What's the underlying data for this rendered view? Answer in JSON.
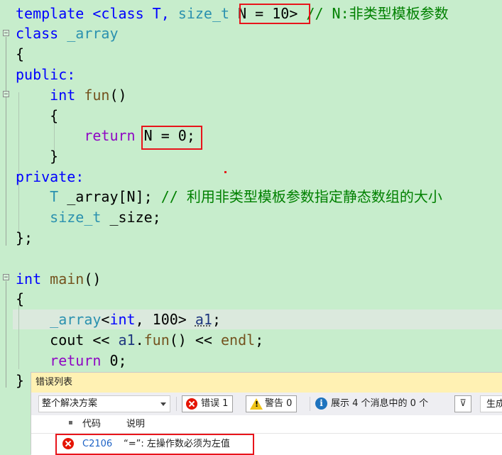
{
  "code": {
    "lines": [
      [
        "template ",
        "<class T, ",
        "size_t",
        " ",
        "N = 10>",
        " // N:非类型模板参数"
      ],
      [
        "class ",
        "_array"
      ],
      [
        "{"
      ],
      [
        "public:"
      ],
      [
        "    ",
        "int",
        " ",
        "fun",
        "()"
      ],
      [
        "    {"
      ],
      [
        "        ",
        "return",
        " ",
        "N = 0;"
      ],
      [
        "    }"
      ],
      [
        "private:"
      ],
      [
        "    ",
        "T",
        " _array[N]; ",
        "// 利用非类型模板参数指定静态数组的大小"
      ],
      [
        "    ",
        "size_t",
        " _size;"
      ],
      [
        "};"
      ],
      [
        ""
      ],
      [
        "int",
        " ",
        "main",
        "()"
      ],
      [
        "{"
      ],
      [
        "    ",
        "_array",
        "<",
        "int",
        ", 100> ",
        "a1",
        ";"
      ],
      [
        "    cout << ",
        "a1",
        ".",
        "fun",
        "() << ",
        "endl",
        ";"
      ],
      [
        "    ",
        "return",
        " 0;"
      ],
      [
        "}"
      ]
    ]
  },
  "panel": {
    "title": "错误列表",
    "scope_select": "整个解决方案",
    "errors_btn": "错误 1",
    "warnings_btn": "警告 0",
    "messages_btn": "展示 4 个消息中的 0 个",
    "build_filter": "生成",
    "col_code": "代码",
    "col_desc": "说明",
    "rows": [
      {
        "code": "C2106",
        "desc": "“=”: 左操作数必须为左值"
      }
    ]
  },
  "colors": {
    "editor_bg": "#c7edcc",
    "keyword": "#0000ff",
    "type": "#2b91af",
    "comment": "#008000",
    "highlight_box": "#e8141b",
    "panel_title_bg": "#fff1b3"
  }
}
